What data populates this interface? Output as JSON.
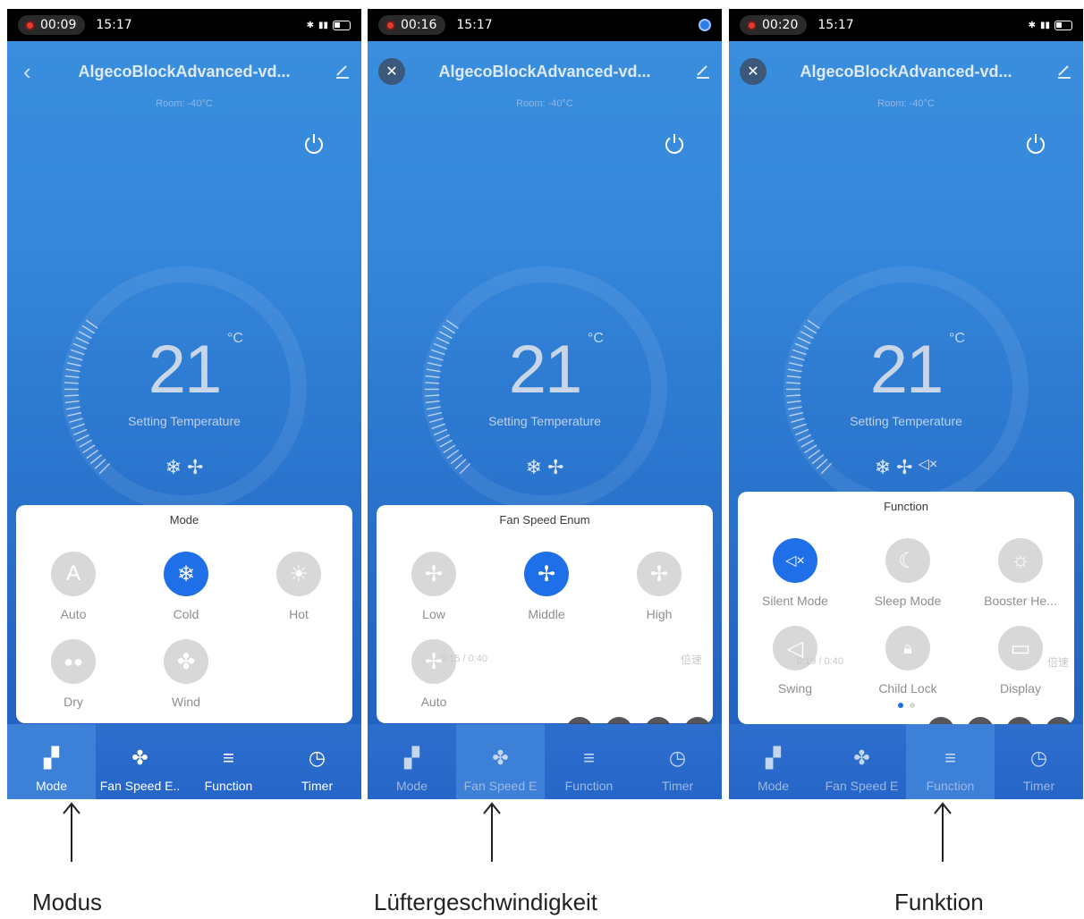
{
  "screens": [
    {
      "recording_time": "00:09",
      "clock": "15:17",
      "title": "AlgecoBlockAdvanced-vd...",
      "room": "Room: -40°C",
      "temperature": "21",
      "unit": "°C",
      "setting_label": "Setting Temperature",
      "status_icons": [
        "snowflake-icon",
        "fan-auto-icon"
      ],
      "panel": {
        "title": "Mode",
        "options": [
          {
            "label": "Auto",
            "icon": "auto-icon",
            "glyph": "A",
            "active": false
          },
          {
            "label": "Cold",
            "icon": "snowflake-icon",
            "glyph": "❄",
            "active": true
          },
          {
            "label": "Hot",
            "icon": "sun-icon",
            "glyph": "☀",
            "active": false
          },
          {
            "label": "Dry",
            "icon": "droplets-icon",
            "glyph": "💧",
            "active": false
          },
          {
            "label": "Wind",
            "icon": "wind-icon",
            "glyph": "✤",
            "active": false
          }
        ]
      },
      "tabs": [
        "Mode",
        "Fan Speed E..",
        "Function",
        "Timer"
      ],
      "active_tab": 0
    },
    {
      "recording_time": "00:16",
      "clock": "15:17",
      "title": "AlgecoBlockAdvanced-vd...",
      "room": "Room: -40°C",
      "temperature": "21",
      "unit": "°C",
      "setting_label": "Setting Temperature",
      "status_icons": [
        "snowflake-icon",
        "fan-icon"
      ],
      "panel": {
        "title": "Fan Speed Enum",
        "options": [
          {
            "label": "Low",
            "icon": "fan-low-icon",
            "active": false
          },
          {
            "label": "Middle",
            "icon": "fan-middle-icon",
            "active": true
          },
          {
            "label": "High",
            "icon": "fan-high-icon",
            "active": false
          },
          {
            "label": "Auto",
            "icon": "fan-auto-icon",
            "active": false
          }
        ]
      },
      "overlay_time": "0:15 / 0:40",
      "overlay_text": "倍速",
      "tabs": [
        "Mode",
        "Fan Speed E",
        "Function",
        "Timer"
      ],
      "active_tab": 1
    },
    {
      "recording_time": "00:20",
      "clock": "15:17",
      "title": "AlgecoBlockAdvanced-vd...",
      "room": "Room: -40°C",
      "temperature": "21",
      "unit": "°C",
      "setting_label": "Setting Temperature",
      "status_icons": [
        "snowflake-icon",
        "fan-icon",
        "mute-icon"
      ],
      "panel": {
        "title": "Function",
        "options": [
          {
            "label": "Silent Mode",
            "icon": "mute-icon",
            "active": true
          },
          {
            "label": "Sleep Mode",
            "icon": "moon-icon",
            "active": false
          },
          {
            "label": "Booster He...",
            "icon": "booster-icon",
            "active": false
          },
          {
            "label": "Swing",
            "icon": "swing-icon",
            "active": false
          },
          {
            "label": "Child Lock",
            "icon": "lock-icon",
            "active": false
          },
          {
            "label": "Display",
            "icon": "display-icon",
            "active": false
          }
        ],
        "pages": 2,
        "current_page": 1
      },
      "overlay_time": "0:19 / 0:40",
      "overlay_text": "倍速",
      "tabs": [
        "Mode",
        "Fan Speed E",
        "Function",
        "Timer"
      ],
      "active_tab": 2
    }
  ],
  "captions": [
    "Modus",
    "Lüftergeschwindigkeit",
    "Funktion"
  ],
  "colors": {
    "accent": "#1f6fe8",
    "background_top": "#3b8fde",
    "background_bottom": "#1f5cbd"
  }
}
